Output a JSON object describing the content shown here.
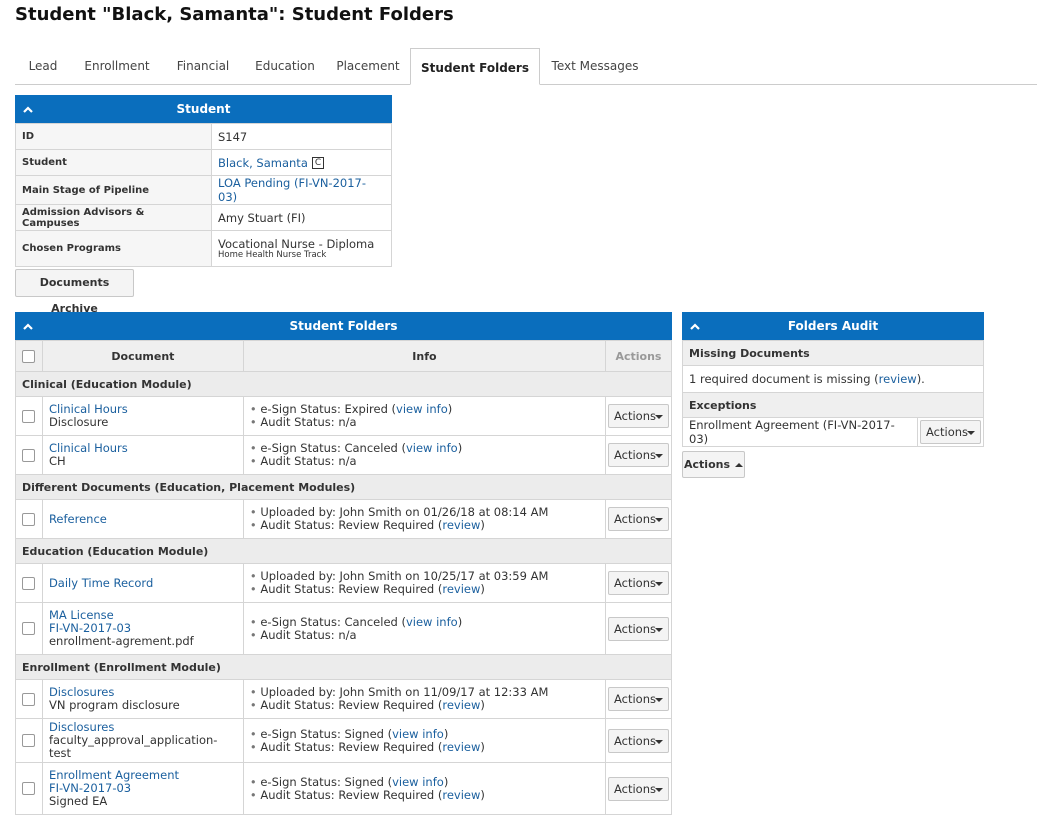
{
  "page": {
    "title": "Student \"Black, Samanta\": Student Folders"
  },
  "tabs": [
    {
      "label": "Lead"
    },
    {
      "label": "Enrollment"
    },
    {
      "label": "Financial"
    },
    {
      "label": "Education"
    },
    {
      "label": "Placement"
    },
    {
      "label": "Student Folders"
    },
    {
      "label": "Text Messages"
    }
  ],
  "student_panel": {
    "title": "Student",
    "rows": [
      {
        "label": "ID",
        "value": "S147"
      },
      {
        "label": "Student",
        "value": "Black, Samanta",
        "badge": "C"
      },
      {
        "label": "Main Stage of Pipeline",
        "value": "LOA Pending (FI-VN-2017-03)"
      },
      {
        "label": "Admission Advisors & Campuses",
        "value": "Amy Stuart (FI)"
      },
      {
        "label": "Chosen Programs",
        "value": "Vocational Nurse - Diploma",
        "sub": "Home Health Nurse Track"
      }
    ]
  },
  "documents_archive_label": "Documents Archive",
  "folders_panel": {
    "title": "Student Folders",
    "headers": {
      "document": "Document",
      "info": "Info",
      "actions": "Actions"
    },
    "action_label": "Actions",
    "groups": [
      {
        "name": "Clinical (Education Module)",
        "rows": [
          {
            "doc_link": "Clinical Hours",
            "doc_sub": "Disclosure",
            "info1": "e-Sign Status: Expired (",
            "info1_link": "view info",
            "info1_end": ")",
            "info2": "Audit Status: n/a",
            "info2_link": "",
            "info2_end": ""
          },
          {
            "doc_link": "Clinical Hours",
            "doc_sub": "CH",
            "info1": "e-Sign Status: Canceled (",
            "info1_link": "view info",
            "info1_end": ")",
            "info2": "Audit Status: n/a",
            "info2_link": "",
            "info2_end": ""
          }
        ]
      },
      {
        "name": "Different Documents (Education, Placement Modules)",
        "rows": [
          {
            "doc_link": "Reference",
            "doc_sub": "",
            "info1": "Uploaded by: John Smith on 01/26/18 at 08:14 AM",
            "info1_link": "",
            "info1_end": "",
            "info2": "Audit Status: Review Required (",
            "info2_link": "review",
            "info2_end": ")"
          }
        ]
      },
      {
        "name": "Education (Education Module)",
        "rows": [
          {
            "doc_link": "Daily Time Record",
            "doc_sub": "",
            "info1": "Uploaded by: John Smith on 10/25/17 at 03:59 AM",
            "info1_link": "",
            "info1_end": "",
            "info2": "Audit Status: Review Required (",
            "info2_link": "review",
            "info2_end": ")"
          },
          {
            "doc_link": "MA License",
            "doc_link2": "FI-VN-2017-03",
            "doc_sub": "enrollment-agrement.pdf",
            "info1": "e-Sign Status: Canceled (",
            "info1_link": "view info",
            "info1_end": ")",
            "info2": "Audit Status: n/a",
            "info2_link": "",
            "info2_end": ""
          }
        ]
      },
      {
        "name": "Enrollment (Enrollment Module)",
        "rows": [
          {
            "doc_link": "Disclosures",
            "doc_sub": "VN program disclosure",
            "info1": "Uploaded by: John Smith on 11/09/17 at 12:33 AM",
            "info1_link": "",
            "info1_end": "",
            "info2": "Audit Status: Review Required (",
            "info2_link": "review",
            "info2_end": ")"
          },
          {
            "doc_link": "Disclosures",
            "doc_sub": "faculty_approval_application-test",
            "info1": "e-Sign Status: Signed (",
            "info1_link": "view info",
            "info1_end": ")",
            "info2": "Audit Status: Review Required (",
            "info2_link": "review",
            "info2_end": ")"
          },
          {
            "doc_link": "Enrollment Agreement",
            "doc_link2": "FI-VN-2017-03",
            "doc_sub": "Signed EA",
            "info1": "e-Sign Status: Signed (",
            "info1_link": "view info",
            "info1_end": ")",
            "info2": "Audit Status: Review Required (",
            "info2_link": "review",
            "info2_end": ")"
          }
        ]
      }
    ]
  },
  "audit_panel": {
    "title": "Folders Audit",
    "missing_header": "Missing Documents",
    "missing_text": "1 required document is missing (",
    "missing_link": "review",
    "missing_end": ").",
    "exceptions_header": "Exceptions",
    "exception_item": "Enrollment Agreement (FI-VN-2017-03)",
    "exception_action": "Actions",
    "footer_action": "Actions"
  },
  "colors": {
    "header_blue": "#0a6ebd",
    "link_blue": "#1a5f9e"
  }
}
